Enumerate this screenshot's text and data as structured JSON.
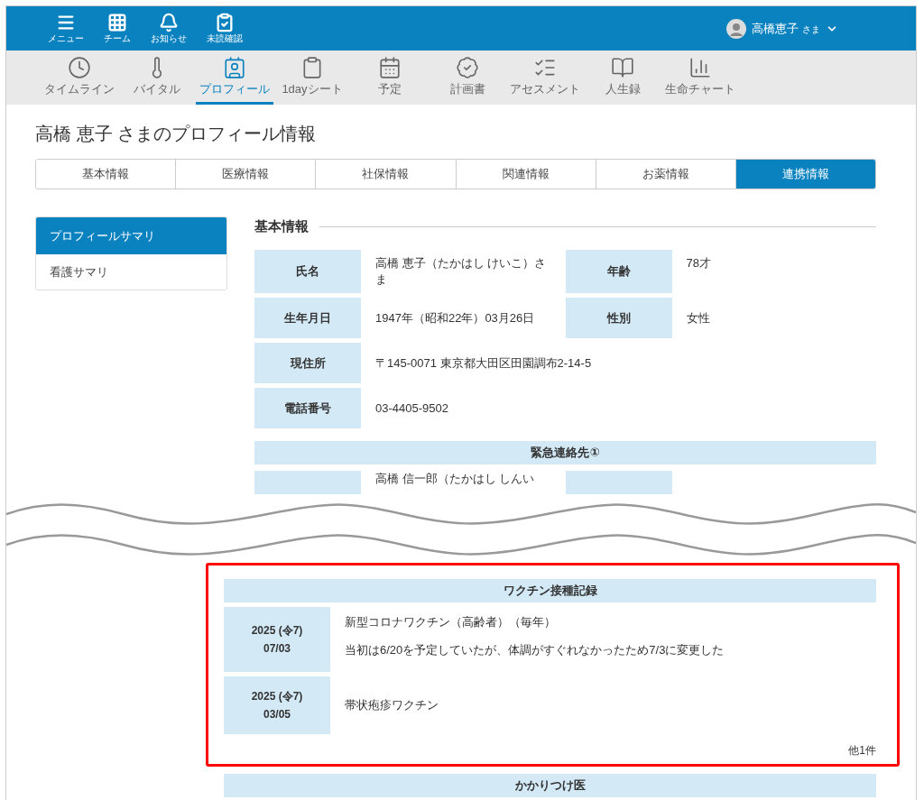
{
  "header": {
    "menu": [
      {
        "kind": "menu",
        "label": "メニュー"
      },
      {
        "kind": "grid",
        "label": "チーム"
      },
      {
        "kind": "bell",
        "label": "お知らせ"
      },
      {
        "kind": "check",
        "label": "未読確認"
      }
    ],
    "user": {
      "name": "高橋恵子",
      "suffix": "さま"
    }
  },
  "nav": [
    {
      "kind": "clock",
      "label": "タイムライン",
      "selected": false
    },
    {
      "kind": "thermo",
      "label": "バイタル",
      "selected": false
    },
    {
      "kind": "card",
      "label": "プロフィール",
      "selected": true
    },
    {
      "kind": "clipboard",
      "label": "1dayシート",
      "selected": false
    },
    {
      "kind": "calendar",
      "label": "予定",
      "selected": false
    },
    {
      "kind": "badge",
      "label": "計画書",
      "selected": false
    },
    {
      "kind": "list",
      "label": "アセスメント",
      "selected": false
    },
    {
      "kind": "book",
      "label": "人生録",
      "selected": false
    },
    {
      "kind": "chart",
      "label": "生命チャート",
      "selected": false
    }
  ],
  "title": "高橋 恵子 さまのプロフィール情報",
  "tabs": [
    {
      "label": "基本情報",
      "selected": false
    },
    {
      "label": "医療情報",
      "selected": false
    },
    {
      "label": "社保情報",
      "selected": false
    },
    {
      "label": "関連情報",
      "selected": false
    },
    {
      "label": "お薬情報",
      "selected": false
    },
    {
      "label": "連携情報",
      "selected": true
    }
  ],
  "sidebar": [
    {
      "label": "プロフィールサマリ",
      "selected": true
    },
    {
      "label": "看護サマリ",
      "selected": false
    }
  ],
  "basic": {
    "heading": "基本情報",
    "rows": [
      [
        {
          "label": "氏名",
          "value": "高橋 恵子（たかはし けいこ）さま"
        },
        {
          "label": "年齢",
          "value": "78才"
        }
      ],
      [
        {
          "label": "生年月日",
          "value": "1947年（昭和22年）03月26日"
        },
        {
          "label": "性別",
          "value": "女性"
        }
      ],
      [
        {
          "label": "現住所",
          "value": "〒145-0071 東京都大田区田園調布2-14-5"
        }
      ],
      [
        {
          "label": "電話番号",
          "value": "03-4405-9502"
        }
      ]
    ]
  },
  "emergency": {
    "heading": "緊急連絡先①",
    "value": "高橋 信一郎（たかはし しんい"
  },
  "vaccine": {
    "heading": "ワクチン接種記録",
    "records": [
      {
        "year": "2025 (令7)",
        "date": "07/03",
        "lines": [
          "新型コロナワクチン（高齢者）（毎年）",
          "当初は6/20を予定していたが、体調がすぐれなかったため7/3に変更した"
        ]
      },
      {
        "year": "2025 (令7)",
        "date": "03/05",
        "lines": [
          "帯状疱疹ワクチン"
        ]
      }
    ],
    "more": "他1件"
  },
  "doctor": {
    "heading": "かかりつけ医"
  }
}
